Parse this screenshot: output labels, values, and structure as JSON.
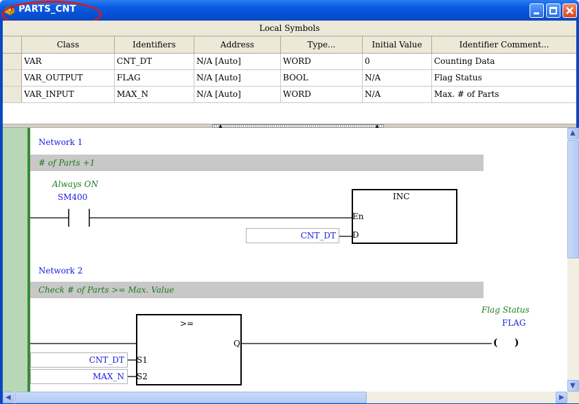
{
  "window": {
    "title": "PARTS_CNT",
    "icon": "folder-tools-icon",
    "buttons": [
      "minimize-icon",
      "maximize-icon",
      "close-icon"
    ]
  },
  "symbols": {
    "caption": "Local Symbols",
    "columns": [
      "Class",
      "Identifiers",
      "Address",
      "Type...",
      "Initial Value",
      "Identifier Comment..."
    ],
    "rows": [
      [
        "VAR",
        "CNT_DT",
        "N/A [Auto]",
        "WORD",
        "0",
        "Counting Data"
      ],
      [
        "VAR_OUTPUT",
        "FLAG",
        "N/A [Auto]",
        "BOOL",
        "N/A",
        "Flag Status"
      ],
      [
        "VAR_INPUT",
        "MAX_N",
        "N/A [Auto]",
        "WORD",
        "N/A",
        "Max. # of Parts"
      ]
    ]
  },
  "ladder": {
    "network1": {
      "title": "Network 1",
      "comment": "# of Parts +1",
      "contact_comment": "Always ON",
      "contact_name": "SM400",
      "block_name": "INC",
      "pin_en": "En",
      "pin_d": "D",
      "operand_d": "CNT_DT"
    },
    "network2": {
      "title": "Network 2",
      "comment": "Check # of Parts >= Max. Value",
      "block_name": ">=",
      "pin_q": "Q",
      "pin_s1": "S1",
      "pin_s2": "S2",
      "operand_s1": "CNT_DT",
      "operand_s2": "MAX_N",
      "coil_comment": "Flag Status",
      "coil_name": "FLAG",
      "coil_symbol": "(     )"
    }
  },
  "colors": {
    "title_bar": "#0a5ce0",
    "highlight_ellipse": "#d71920",
    "rail": "#b7d7b7",
    "comment_bg": "#c8c8c8",
    "identifier_text": "#1a1ae0",
    "comment_text": "#1e7a1e"
  }
}
